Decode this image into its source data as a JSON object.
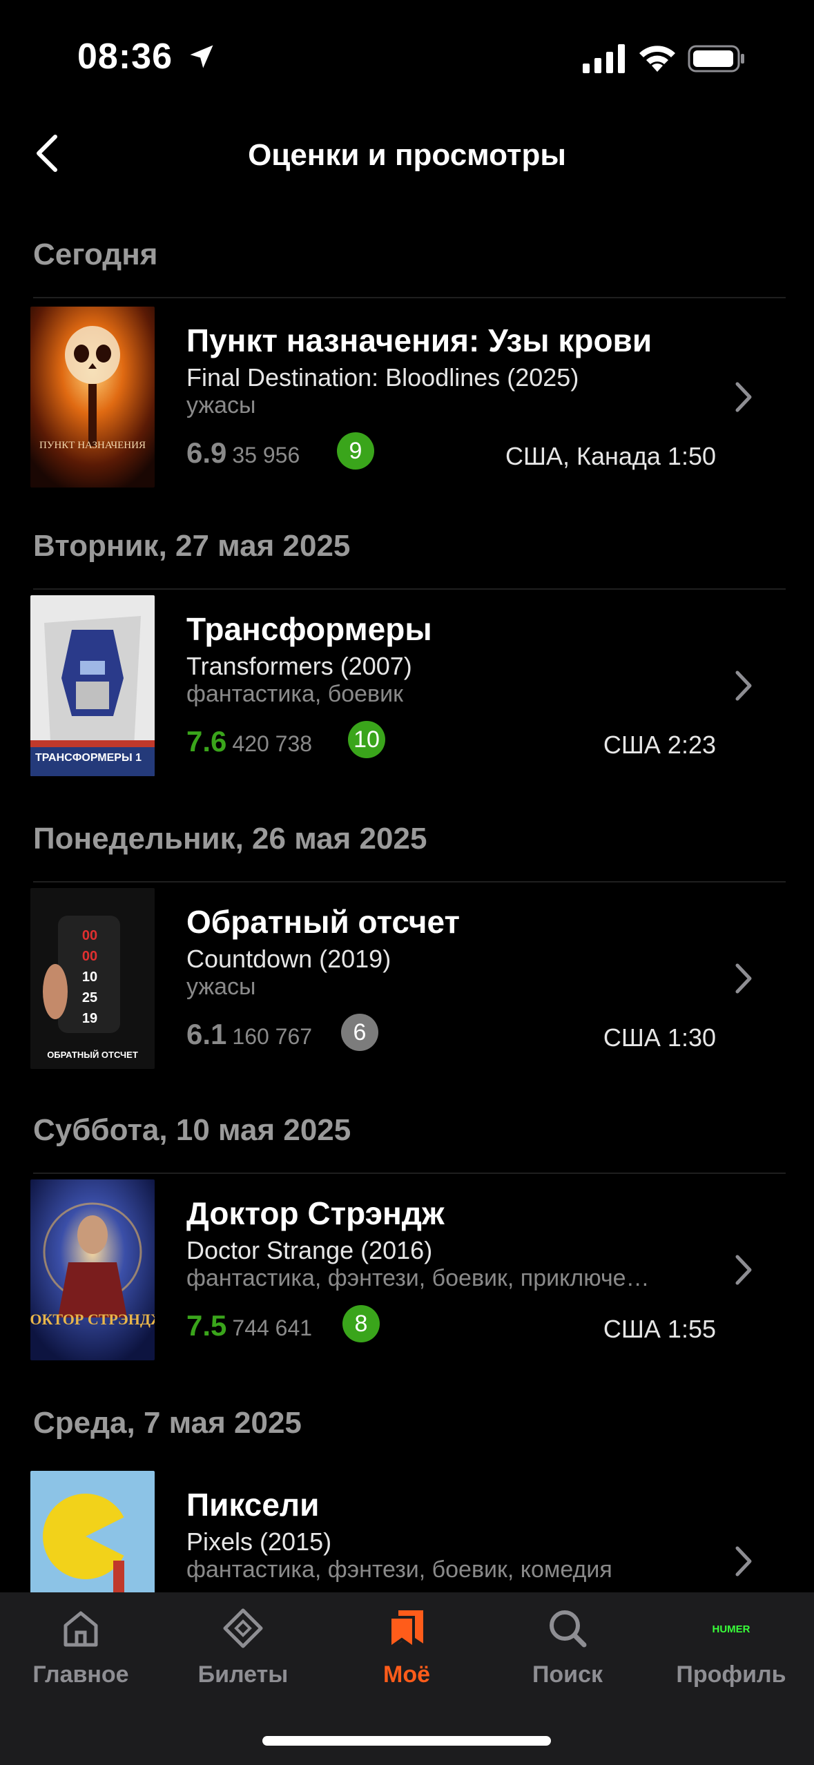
{
  "status_bar": {
    "time": "08:36"
  },
  "header": {
    "title": "Оценки и просмотры"
  },
  "sections": [
    {
      "date": "Сегодня",
      "items": [
        {
          "title": "Пункт назначения: Узы крови",
          "original": "Final Destination: Bloodlines (2025)",
          "genres": "ужасы",
          "rating": "6.9",
          "votes": "35 956",
          "user_score": "9",
          "country_duration": "США, Канада  1:50",
          "rating_color": "#8a8a8a",
          "badge_color": "#3aa51b"
        }
      ]
    },
    {
      "date": "Вторник, 27 мая 2025",
      "items": [
        {
          "title": "Трансформеры",
          "original": "Transformers (2007)",
          "genres": "фантастика, боевик",
          "rating": "7.6",
          "votes": "420 738",
          "user_score": "10",
          "country_duration": "США  2:23",
          "rating_color": "#3aa51b",
          "badge_color": "#3aa51b"
        }
      ]
    },
    {
      "date": "Понедельник, 26 мая 2025",
      "items": [
        {
          "title": "Обратный отсчет",
          "original": "Countdown (2019)",
          "genres": "ужасы",
          "rating": "6.1",
          "votes": "160 767",
          "user_score": "6",
          "country_duration": "США  1:30",
          "rating_color": "#8a8a8a",
          "badge_color": "#7c7c7c"
        }
      ]
    },
    {
      "date": "Суббота, 10 мая 2025",
      "items": [
        {
          "title": "Доктор Стрэндж",
          "original": "Doctor Strange (2016)",
          "genres": "фантастика, фэнтези, боевик, приключе…",
          "rating": "7.5",
          "votes": "744 641",
          "user_score": "8",
          "country_duration": "США  1:55",
          "rating_color": "#3aa51b",
          "badge_color": "#3aa51b"
        }
      ]
    },
    {
      "date": "Среда, 7 мая 2025",
      "items": [
        {
          "title": "Пиксели",
          "original": "Pixels (2015)",
          "genres": "фантастика, фэнтези, боевик, комедия"
        }
      ]
    }
  ],
  "posters": {
    "p1": {
      "text": "ПУНКТ НАЗНАЧЕНИЯ"
    },
    "p2": {
      "text": "ТРАНСФОРМЕРЫ 1"
    },
    "p3": {
      "text": "ОБРАТНЫЙ ОТСЧЕТ",
      "digits": [
        "00",
        "00",
        "10",
        "25",
        "19"
      ]
    },
    "p4": {
      "text": "ДОКТОР СТРЭНДЖ"
    }
  },
  "tabbar": {
    "tabs": [
      {
        "label": "Главное",
        "icon": "home-icon"
      },
      {
        "label": "Билеты",
        "icon": "ticket-icon"
      },
      {
        "label": "Моё",
        "icon": "bookmarks-icon",
        "active": true
      },
      {
        "label": "Поиск",
        "icon": "search-icon"
      },
      {
        "label": "Профиль",
        "icon": "profile-avatar-icon"
      }
    ],
    "avatar_text": "HUMER",
    "active_color": "#ff5c1a"
  }
}
